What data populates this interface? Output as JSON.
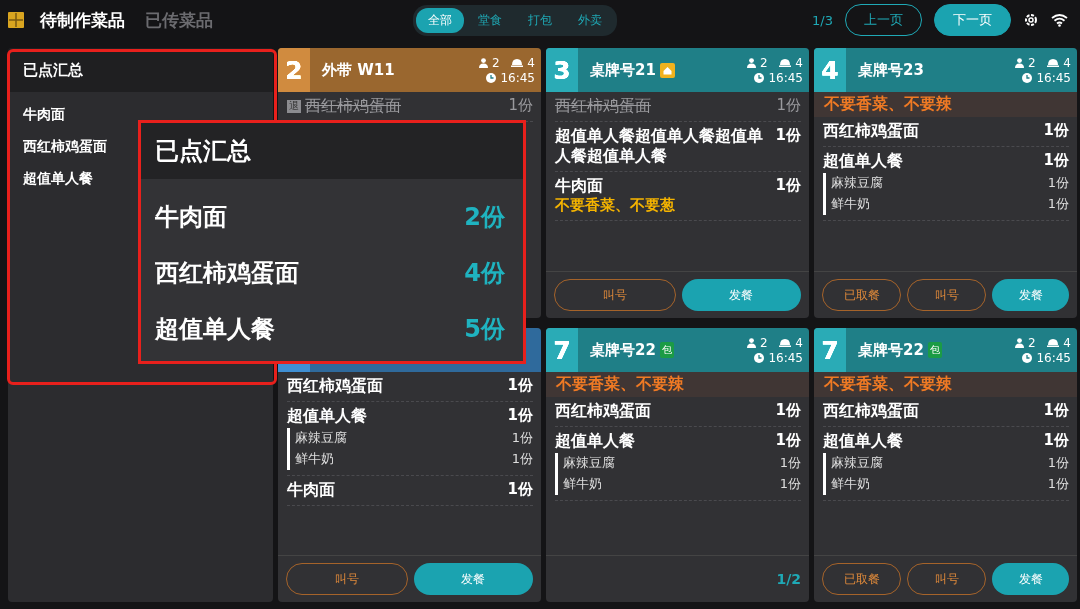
{
  "top_bar": {
    "tabs": [
      {
        "label": "待制作菜品",
        "selected": true
      },
      {
        "label": "已传菜品",
        "selected": false
      }
    ],
    "filters": [
      {
        "label": "全部",
        "selected": true
      },
      {
        "label": "堂食",
        "selected": false
      },
      {
        "label": "打包",
        "selected": false
      },
      {
        "label": "外卖",
        "selected": false
      }
    ],
    "page": "1/3",
    "prev_button": "上一页",
    "next_button": "下一页"
  },
  "summary_panel": {
    "title": "已点汇总",
    "items": [
      {
        "name": "牛肉面"
      },
      {
        "name": "西红柿鸡蛋面"
      },
      {
        "name": "超值单人餐"
      }
    ]
  },
  "summary_popup": {
    "title": "已点汇总",
    "items": [
      {
        "name": "牛肉面",
        "count": "2份"
      },
      {
        "name": "西红柿鸡蛋面",
        "count": "4份"
      },
      {
        "name": "超值单人餐",
        "count": "5份"
      }
    ]
  },
  "orders": [
    {
      "color": "#9a672f",
      "number": "2",
      "title": "外带 W11",
      "guests": "2",
      "dishes": "4",
      "time": "16:45",
      "items": [
        {
          "name": "西红柿鸡蛋面",
          "qty": "1份",
          "cancelled": true,
          "tag": "退"
        }
      ]
    },
    {
      "color": "#1f7f87",
      "number": "3",
      "title": "桌牌号21",
      "badge": {
        "kind": "icon"
      },
      "guests": "2",
      "dishes": "4",
      "time": "16:45",
      "items": [
        {
          "name": "西红柿鸡蛋面",
          "qty": "1份",
          "cancelled": true
        },
        {
          "name": "超值单人餐超值单人餐超值单人餐超值单人餐",
          "qty": "1份",
          "cancelled": false
        },
        {
          "name": "牛肉面",
          "qty": "1份",
          "cancelled": false,
          "note": "不要香菜、不要葱"
        }
      ],
      "buttons": [
        {
          "label": "叫号",
          "kind": "outline"
        },
        {
          "label": "发餐",
          "kind": "primary"
        }
      ]
    },
    {
      "color": "#1f7f87",
      "number": "4",
      "title": "桌牌号23",
      "guests": "2",
      "dishes": "4",
      "time": "16:45",
      "note": "不要香菜、不要辣",
      "items": [
        {
          "name": "西红柿鸡蛋面",
          "qty": "1份",
          "cancelled": false
        },
        {
          "name": "超值单人餐",
          "qty": "1份",
          "cancelled": false,
          "subitems": [
            {
              "name": "麻辣豆腐",
              "qty": "1份"
            },
            {
              "name": "鲜牛奶",
              "qty": "1份"
            }
          ]
        }
      ],
      "buttons": [
        {
          "label": "已取餐",
          "kind": "outline"
        },
        {
          "label": "叫号",
          "kind": "outline"
        },
        {
          "label": "发餐",
          "kind": "primary"
        }
      ]
    },
    {
      "color": "#2f6a9c",
      "items": [
        {
          "name": "西红柿鸡蛋面",
          "qty": "1份",
          "cancelled": false
        },
        {
          "name": "超值单人餐",
          "qty": "1份",
          "cancelled": false,
          "subitems": [
            {
              "name": "麻辣豆腐",
              "qty": "1份"
            },
            {
              "name": "鲜牛奶",
              "qty": "1份"
            }
          ]
        },
        {
          "name": "牛肉面",
          "qty": "1份",
          "cancelled": false
        }
      ],
      "buttons": [
        {
          "label": "叫号",
          "kind": "outline"
        },
        {
          "label": "发餐",
          "kind": "primary"
        }
      ]
    },
    {
      "color": "#1f7f87",
      "number": "7",
      "title": "桌牌号22",
      "badge": {
        "kind": "text",
        "text": "包"
      },
      "guests": "2",
      "dishes": "4",
      "time": "16:45",
      "note": "不要香菜、不要辣",
      "items": [
        {
          "name": "西红柿鸡蛋面",
          "qty": "1份",
          "cancelled": false
        },
        {
          "name": "超值单人餐",
          "qty": "1份",
          "cancelled": false,
          "subitems": [
            {
              "name": "麻辣豆腐",
              "qty": "1份"
            },
            {
              "name": "鲜牛奶",
              "qty": "1份"
            }
          ]
        }
      ],
      "page": "1/2"
    },
    {
      "color": "#1f7f87",
      "number": "7",
      "title": "桌牌号22",
      "badge": {
        "kind": "text",
        "text": "包"
      },
      "guests": "2",
      "dishes": "4",
      "time": "16:45",
      "note": "不要香菜、不要辣",
      "items": [
        {
          "name": "西红柿鸡蛋面",
          "qty": "1份",
          "cancelled": false
        },
        {
          "name": "超值单人餐",
          "qty": "1份",
          "cancelled": false,
          "subitems": [
            {
              "name": "麻辣豆腐",
              "qty": "1份"
            },
            {
              "name": "鲜牛奶",
              "qty": "1份"
            }
          ]
        }
      ],
      "buttons": [
        {
          "label": "已取餐",
          "kind": "outline"
        },
        {
          "label": "叫号",
          "kind": "outline"
        },
        {
          "label": "发餐",
          "kind": "primary"
        }
      ]
    }
  ]
}
